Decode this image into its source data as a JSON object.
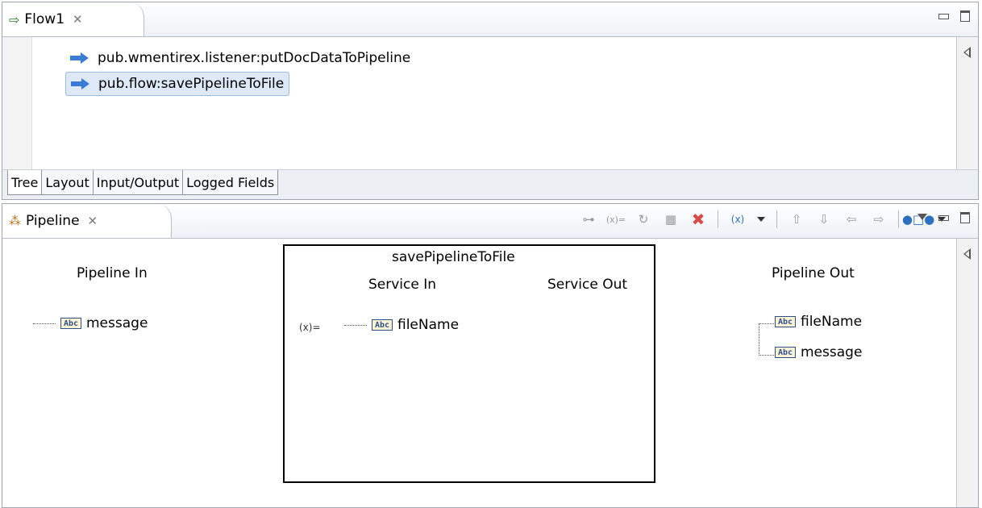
{
  "flow_view": {
    "tab_title": "Flow1",
    "close_glyph": "✕",
    "steps": [
      {
        "label": "pub.wmentirex.listener:putDocDataToPipeline",
        "icon": "invoke-arrow-icon",
        "selected": false
      },
      {
        "label": "pub.flow:savePipelineToFile",
        "icon": "invoke-arrow-icon",
        "selected": true
      }
    ],
    "bottom_tabs": [
      "Tree",
      "Layout",
      "Input/Output",
      "Logged Fields"
    ],
    "active_bottom_tab": "Tree"
  },
  "pipeline_view": {
    "tab_title": "Pipeline",
    "close_glyph": "✕",
    "toolbar": {
      "icons": [
        "link-icon",
        "map-set-value-icon",
        "refresh-icon",
        "map-tree-icon",
        "delete-icon",
        "insert-variable-icon",
        "shift-up-icon",
        "shift-down-icon",
        "shift-left-icon",
        "shift-right-icon",
        "link-options-icon"
      ]
    },
    "pipeline_in": {
      "title": "Pipeline In",
      "variables": [
        {
          "name": "message",
          "type": "Abc"
        }
      ]
    },
    "service": {
      "name": "savePipelineToFile",
      "service_in_title": "Service In",
      "service_out_title": "Service Out",
      "inputs": [
        {
          "name": "fileName",
          "type": "Abc"
        }
      ],
      "set_value_glyph": "(x)="
    },
    "pipeline_out": {
      "title": "Pipeline Out",
      "variables": [
        {
          "name": "fileName",
          "type": "Abc"
        },
        {
          "name": "message",
          "type": "Abc"
        }
      ]
    }
  }
}
